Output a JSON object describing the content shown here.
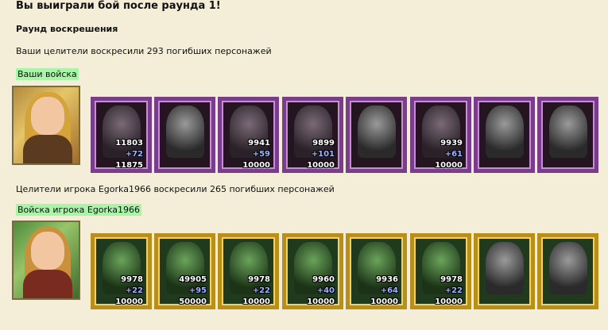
{
  "header": {
    "title": "Вы выиграли бой после раунда 1!",
    "subtitle": "Раунд воскрешения",
    "your_healers": "Ваши целители воскресили 293 погибших персонажей",
    "your_troops": "Ваши войска",
    "enemy_healers": "Целители игрока Egorka1966 воскресили 265 погибших персонажей",
    "enemy_troops": "Войска игрока Egorka1966"
  },
  "your_units": [
    {
      "before": "11803",
      "delta": "+72",
      "after": "11875"
    },
    {
      "before": "",
      "delta": "",
      "after": ""
    },
    {
      "before": "9941",
      "delta": "+59",
      "after": "10000"
    },
    {
      "before": "9899",
      "delta": "+101",
      "after": "10000"
    },
    {
      "before": "",
      "delta": "",
      "after": ""
    },
    {
      "before": "9939",
      "delta": "+61",
      "after": "10000"
    },
    {
      "before": "",
      "delta": "",
      "after": ""
    },
    {
      "before": "",
      "delta": "",
      "after": ""
    }
  ],
  "enemy_units": [
    {
      "before": "9978",
      "delta": "+22",
      "after": "10000"
    },
    {
      "before": "49905",
      "delta": "+95",
      "after": "50000"
    },
    {
      "before": "9978",
      "delta": "+22",
      "after": "10000"
    },
    {
      "before": "9960",
      "delta": "+40",
      "after": "10000"
    },
    {
      "before": "9936",
      "delta": "+64",
      "after": "10000"
    },
    {
      "before": "9978",
      "delta": "+22",
      "after": "10000"
    },
    {
      "before": "",
      "delta": "",
      "after": ""
    },
    {
      "before": "",
      "delta": "",
      "after": ""
    }
  ],
  "colors": {
    "background": "#f4eed8",
    "badge": "#a8f5a8",
    "your_frame": "#7a3d8c",
    "enemy_frame": "#b98f1c",
    "delta_text": "#9fb4ff"
  }
}
